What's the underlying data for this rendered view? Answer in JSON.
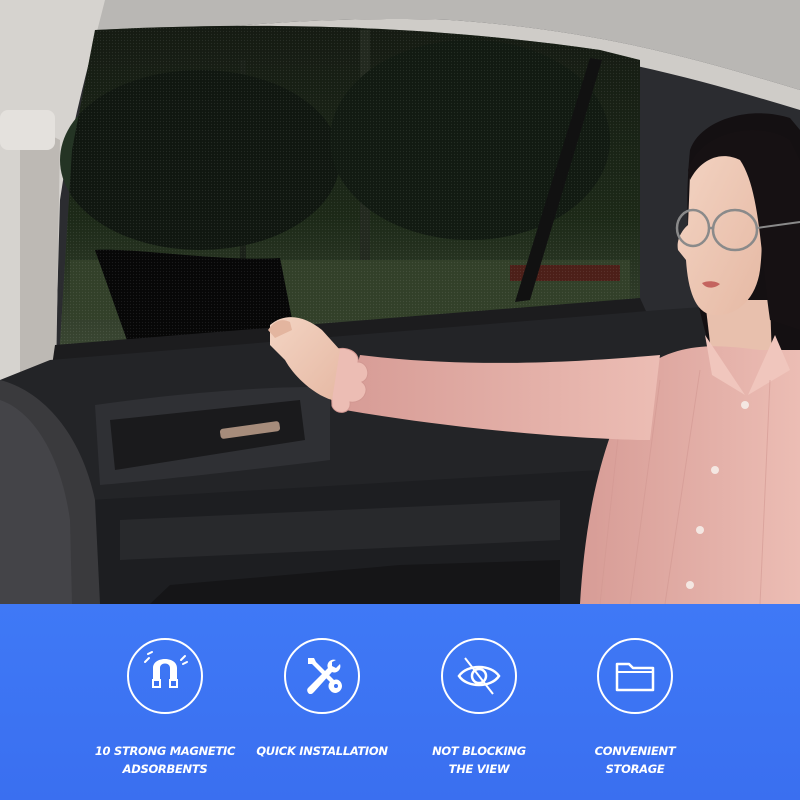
{
  "features": [
    {
      "icon": "magnet-icon",
      "line1": "10 STRONG MAGNETIC",
      "line2": "ADSORBENTS"
    },
    {
      "icon": "tools-icon",
      "line1": "QUICK INSTALLATION",
      "line2": ""
    },
    {
      "icon": "eye-slash-icon",
      "line1": "NOT BLOCKING",
      "line2": "THE VIEW"
    },
    {
      "icon": "folder-icon",
      "line1": "CONVENIENT",
      "line2": "STORAGE"
    }
  ],
  "colors": {
    "banner": "#3d72f2",
    "icon_and_text": "#ffffff",
    "blouse": "#e3aea7",
    "shade": "#151515"
  }
}
